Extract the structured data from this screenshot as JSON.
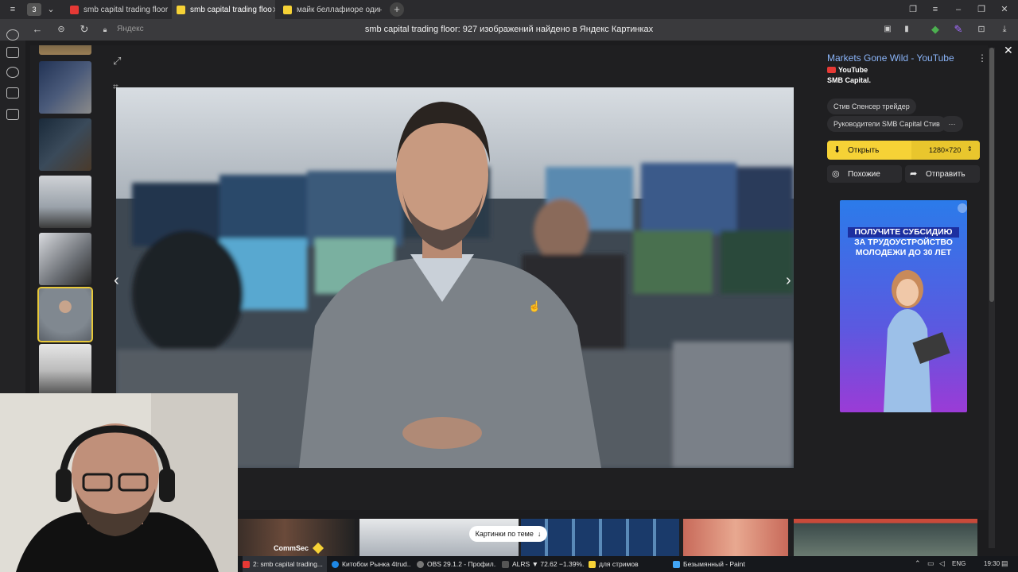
{
  "tabs": {
    "counter": "3",
    "items": [
      {
        "label": "smb capital trading floor —",
        "color": "#e53935"
      },
      {
        "label": "smb capital trading floo",
        "color": "#f6d236",
        "active": true
      },
      {
        "label": "майк беллафиоре один ж",
        "color": "#f6d236"
      }
    ],
    "new_tab": "+"
  },
  "address": {
    "domain": "Яндекс",
    "title": "smb capital trading floor: 927 изображений найдено в Яндекс Картинках"
  },
  "source": {
    "title": "Markets Gone Wild - YouTube",
    "site": "YouTube",
    "channel": "SMB Capital.",
    "more": "⋮"
  },
  "tags": [
    "Стив Спенсер трейдер",
    "Руководители SMB Capital Стив",
    "···"
  ],
  "actions": {
    "open": "Открыть",
    "size": "1280×720",
    "similar": "Похожие",
    "share": "Отправить"
  },
  "ad": {
    "line1": "ПОЛУЧИТЕ СУБСИДИЮ",
    "line2": "ЗА ТРУДОУСТРОЙСТВО",
    "line3": "МОЛОДЕЖИ ДО 30 ЛЕТ"
  },
  "related": {
    "label": "Картинки по теме",
    "arrow": "↓",
    "first_caption": "CommSec"
  },
  "taskbar": {
    "items": [
      {
        "label": "2: smb capital trading...",
        "color": "#e53935",
        "active": true
      },
      {
        "label": "Китобои Рынка 4trud...",
        "color": "#1e88e5"
      },
      {
        "label": "OBS 29.1.2 - Профил...",
        "color": "#777777"
      },
      {
        "label": "ALRS ▼ 72.62 −1.39%...",
        "color": "#555555"
      },
      {
        "label": "для стримов",
        "color": "#f6d236"
      },
      {
        "label": "Безымянный - Paint",
        "color": "#42a5f5"
      }
    ],
    "lang": "ENG",
    "time": "19:30"
  },
  "colors": {
    "accent": "#f6d236",
    "link": "#8ab4f8",
    "bg": "#1f1f21"
  }
}
